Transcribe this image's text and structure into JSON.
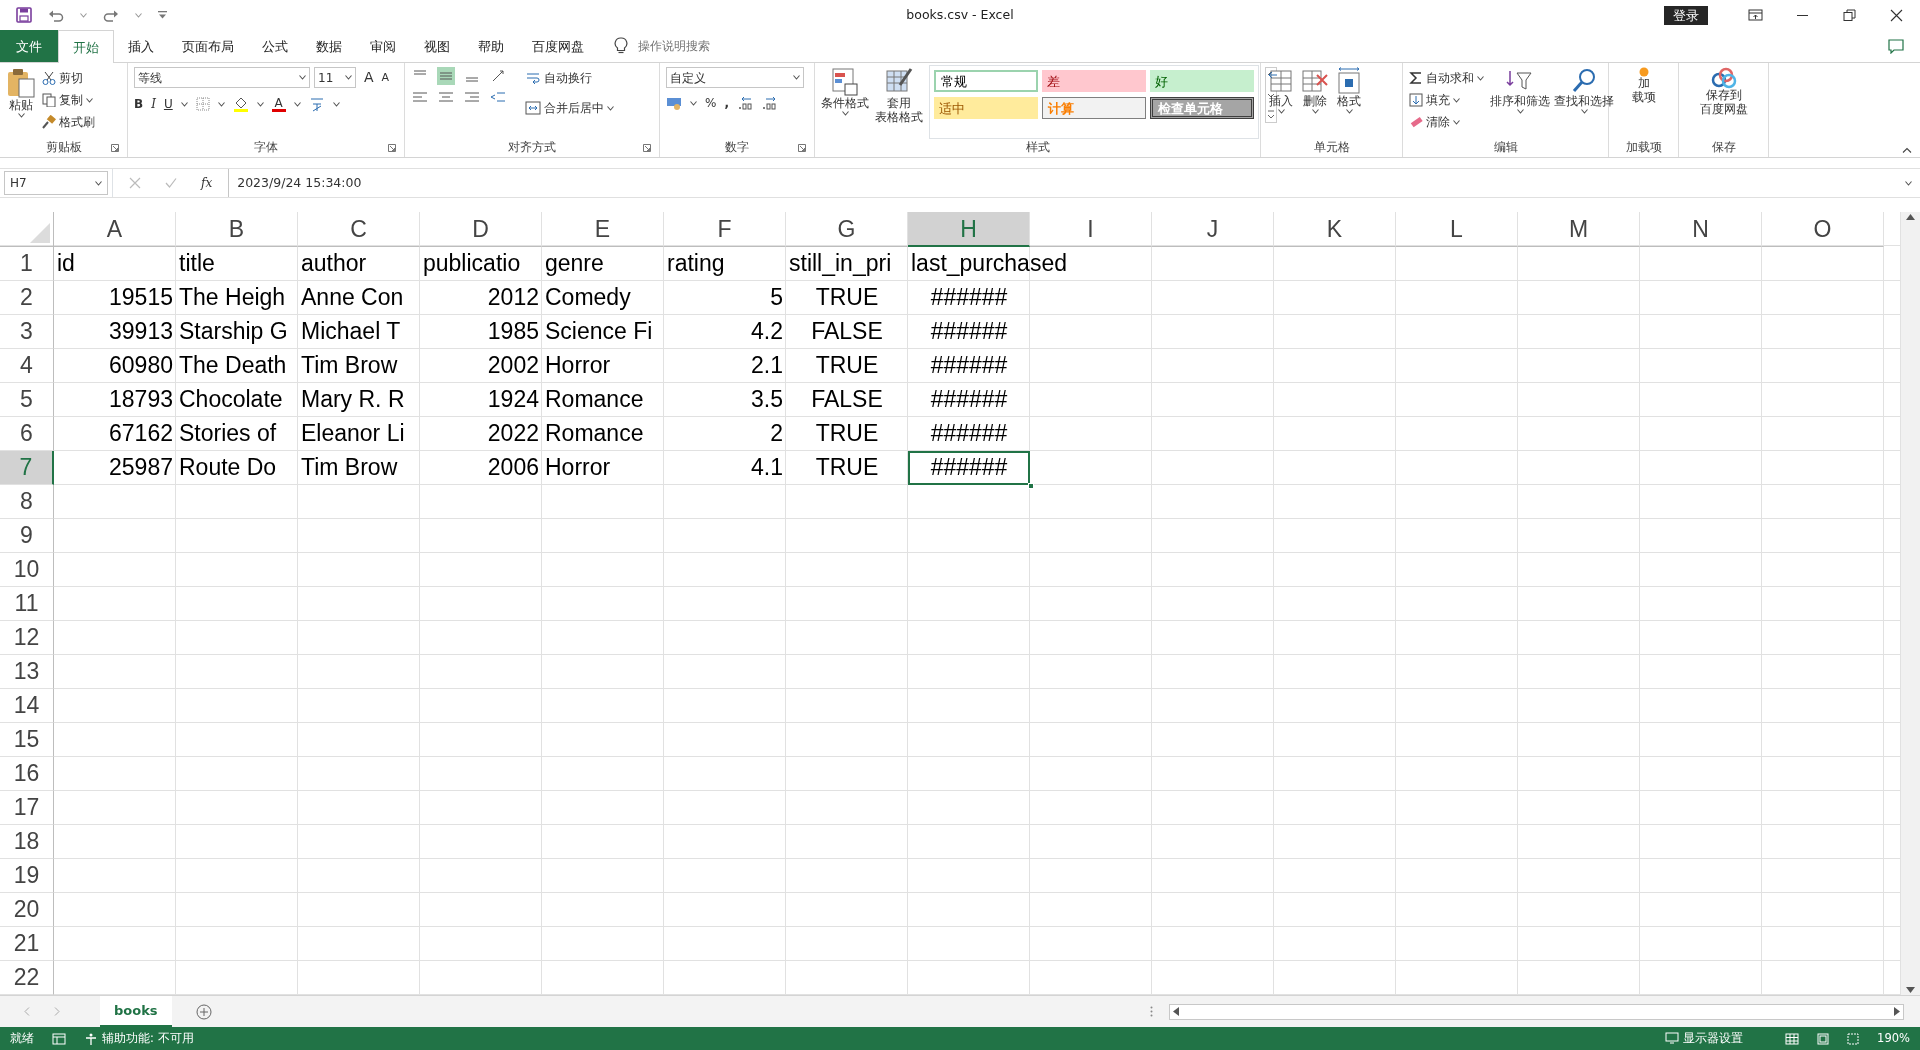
{
  "window": {
    "title": "books.csv  -  Excel",
    "sign_in": "登录"
  },
  "ribbon_tabs": [
    {
      "label": "文件",
      "kind": "backstage",
      "selected": false
    },
    {
      "label": "开始",
      "kind": "tab",
      "selected": true
    },
    {
      "label": "插入",
      "kind": "tab",
      "selected": false
    },
    {
      "label": "页面布局",
      "kind": "tab",
      "selected": false
    },
    {
      "label": "公式",
      "kind": "tab",
      "selected": false
    },
    {
      "label": "数据",
      "kind": "tab",
      "selected": false
    },
    {
      "label": "审阅",
      "kind": "tab",
      "selected": false
    },
    {
      "label": "视图",
      "kind": "tab",
      "selected": false
    },
    {
      "label": "帮助",
      "kind": "tab",
      "selected": false
    },
    {
      "label": "百度网盘",
      "kind": "tab",
      "selected": false
    }
  ],
  "tell_me": {
    "placeholder": "操作说明搜索"
  },
  "clipboard": {
    "paste": "粘贴",
    "cut": "剪切",
    "copy": "复制",
    "format_painter": "格式刷",
    "label": "剪贴板"
  },
  "font": {
    "name": "等线",
    "size": "11",
    "grow_font": "A",
    "shrink_font": "A",
    "bold": "B",
    "italic": "I",
    "underline": "U",
    "font_color": "A",
    "label": "字体"
  },
  "alignment": {
    "wrap_text": "自动换行",
    "merge_center": "合并后居中",
    "label": "对齐方式"
  },
  "number": {
    "format": "自定义",
    "percent": "%",
    "comma": ",",
    "label": "数字"
  },
  "styles": {
    "conditional_formatting": "条件格式",
    "format_as_table": [
      "套用",
      "表格格式"
    ],
    "label": "样式",
    "cell_styles": [
      {
        "label": "常规",
        "kind": "normal",
        "color": "#ffffff"
      },
      {
        "label": "差",
        "kind": "bad",
        "color": "#ffc7ce"
      },
      {
        "label": "好",
        "kind": "good",
        "color": "#c6efce"
      },
      {
        "label": "适中",
        "kind": "neutral",
        "color": "#ffeb9c"
      },
      {
        "label": "计算",
        "kind": "calculation",
        "color": "#f2f2f2"
      },
      {
        "label": "检查单元格",
        "kind": "check",
        "color": "#a5a5a5"
      }
    ]
  },
  "cells": {
    "insert": "插入",
    "delete": "删除",
    "format": "格式",
    "label": "单元格"
  },
  "editing": {
    "autosum": "自动求和",
    "fill": "填充",
    "clear": "清除",
    "sort_filter": "排序和筛选",
    "find_select": "查找和选择",
    "label": "编辑"
  },
  "addins": {
    "button": [
      "加",
      "载项"
    ],
    "label": "加载项"
  },
  "save_group": {
    "button": [
      "保存到",
      "百度网盘"
    ],
    "label": "保存"
  },
  "formula_bar": {
    "name_box": "H7",
    "function_button": "fx",
    "formula": "2023/9/24  15:34:00"
  },
  "sheet": {
    "columns": [
      {
        "label": "A",
        "kind": "number",
        "selected": false
      },
      {
        "label": "B",
        "kind": "text",
        "selected": false
      },
      {
        "label": "C",
        "kind": "text",
        "selected": false
      },
      {
        "label": "D",
        "kind": "number",
        "selected": false
      },
      {
        "label": "E",
        "kind": "text",
        "selected": false
      },
      {
        "label": "F",
        "kind": "number",
        "selected": false
      },
      {
        "label": "G",
        "kind": "boolean",
        "selected": false
      },
      {
        "label": "H",
        "kind": "date",
        "selected": true
      },
      {
        "label": "I",
        "selected": false
      },
      {
        "label": "J",
        "selected": false
      },
      {
        "label": "K",
        "selected": false
      },
      {
        "label": "L",
        "selected": false
      },
      {
        "label": "M",
        "selected": false
      },
      {
        "label": "N",
        "selected": false
      },
      {
        "label": "O",
        "selected": false
      }
    ],
    "rows": [
      {
        "label": "1",
        "kind": "header",
        "selected": false,
        "cells": [
          "id",
          "title",
          "author",
          "publicatio",
          "genre",
          "rating",
          "still_in_pri",
          "last_purchased"
        ]
      },
      {
        "label": "2",
        "kind": "data",
        "selected": false,
        "cells": [
          "19515",
          "The Heigh",
          "Anne Con",
          "2012",
          "Comedy",
          "5",
          "TRUE",
          "######"
        ]
      },
      {
        "label": "3",
        "kind": "data",
        "selected": false,
        "cells": [
          "39913",
          "Starship G",
          "Michael T",
          "1985",
          "Science Fi",
          "4.2",
          "FALSE",
          "######"
        ]
      },
      {
        "label": "4",
        "kind": "data",
        "selected": false,
        "cells": [
          "60980",
          "The Death",
          "Tim Brow",
          "2002",
          "Horror",
          "2.1",
          "TRUE",
          "######"
        ]
      },
      {
        "label": "5",
        "kind": "data",
        "selected": false,
        "cells": [
          "18793",
          "Chocolate",
          "Mary R. R",
          "1924",
          "Romance",
          "3.5",
          "FALSE",
          "######"
        ]
      },
      {
        "label": "6",
        "kind": "data",
        "selected": false,
        "cells": [
          "67162",
          "Stories of",
          "Eleanor Li",
          "2022",
          "Romance",
          "2",
          "TRUE",
          "######"
        ]
      },
      {
        "label": "7",
        "kind": "data",
        "selected": true,
        "cells": [
          "25987",
          "Route Do",
          "Tim Brow",
          "2006",
          "Horror",
          "4.1",
          "TRUE",
          "######"
        ]
      },
      {
        "label": "8",
        "selected": false
      },
      {
        "label": "9",
        "selected": false
      },
      {
        "label": "10",
        "selected": false
      },
      {
        "label": "11",
        "selected": false
      },
      {
        "label": "12",
        "selected": false
      },
      {
        "label": "13",
        "selected": false
      },
      {
        "label": "14",
        "selected": false
      },
      {
        "label": "15",
        "selected": false
      },
      {
        "label": "16",
        "selected": false
      },
      {
        "label": "17",
        "selected": false
      },
      {
        "label": "18",
        "selected": false
      },
      {
        "label": "19",
        "selected": false
      },
      {
        "label": "20",
        "selected": false
      },
      {
        "label": "21",
        "selected": false
      },
      {
        "label": "22",
        "selected": false
      }
    ]
  },
  "sheet_tabs": [
    {
      "label": "books",
      "selected": true
    }
  ],
  "status_bar": {
    "mode": "就绪",
    "accessibility": "辅助功能: 不可用",
    "display_settings": "显示器设置",
    "zoom": "190%"
  }
}
